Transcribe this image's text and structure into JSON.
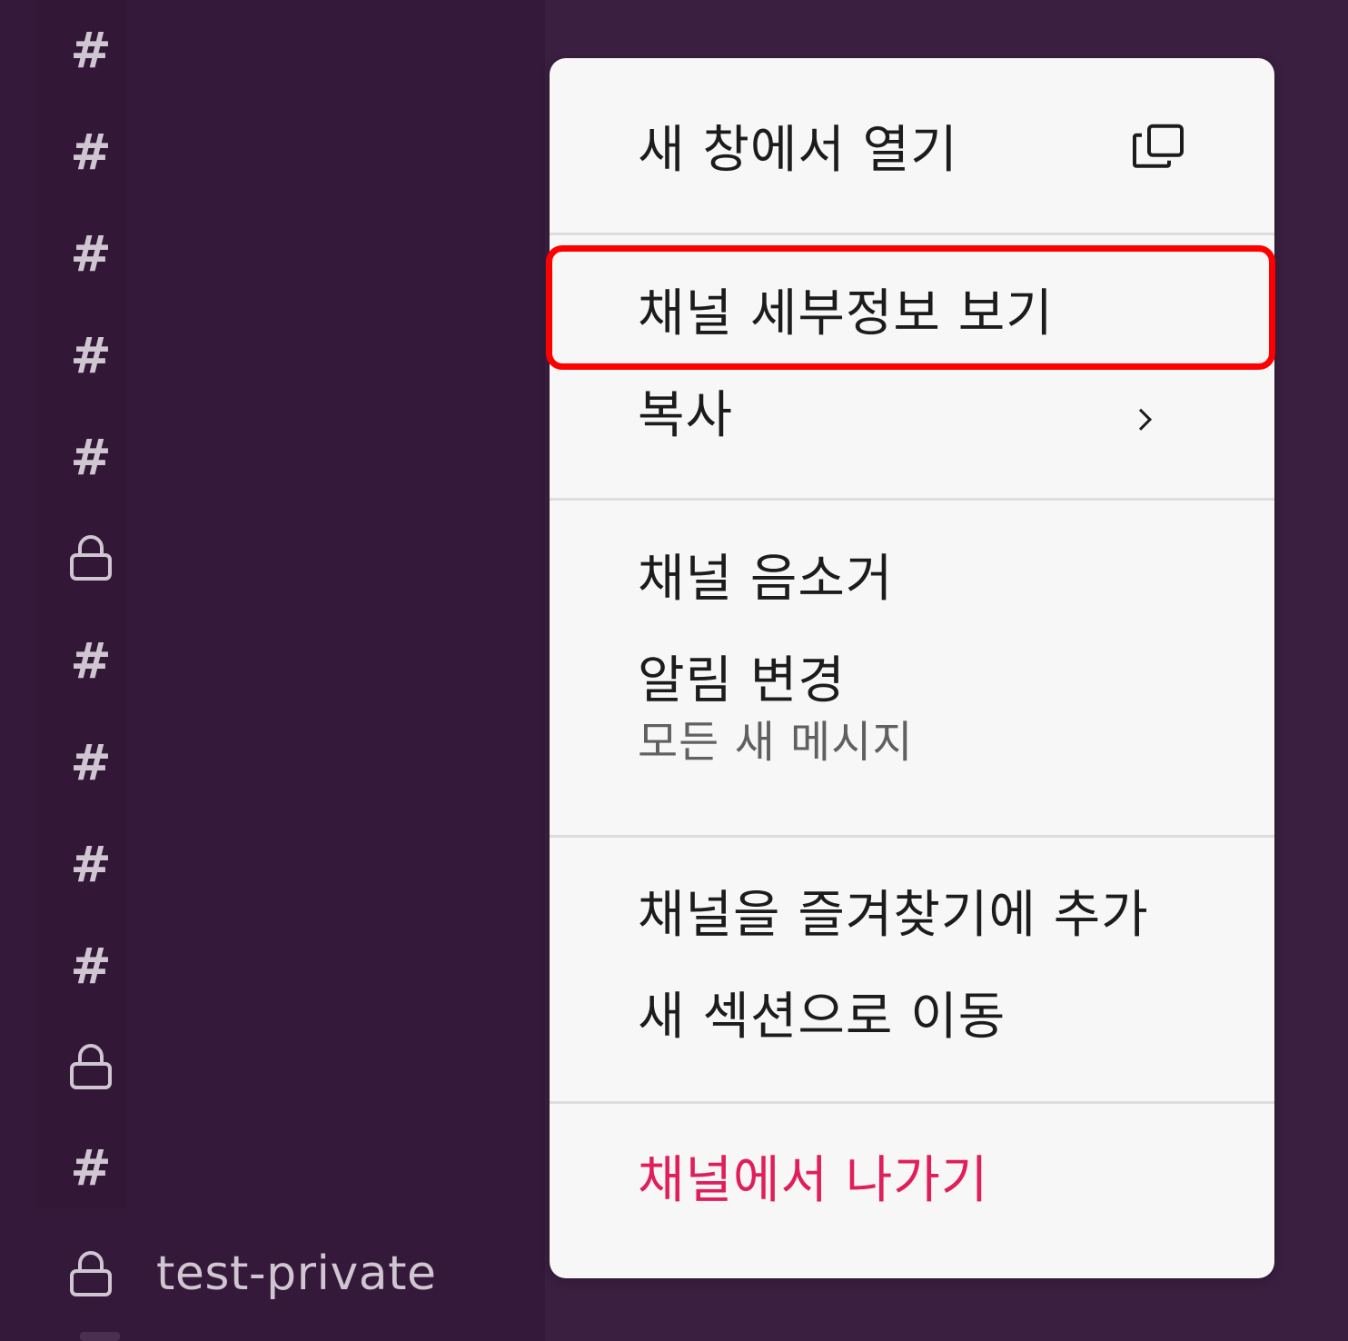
{
  "sidebar": {
    "icons": [
      "hash-icon",
      "hash-icon",
      "hash-icon",
      "hash-icon",
      "hash-icon",
      "lock-icon",
      "hash-icon",
      "hash-icon",
      "hash-icon",
      "hash-icon",
      "lock-icon",
      "hash-icon"
    ],
    "hash_glyph": "#",
    "visible_channel": {
      "icon": "lock-icon",
      "name": "test-private"
    }
  },
  "context_menu": {
    "open_in_new_window": {
      "label": "새 창에서 열기",
      "icon": "new-window-icon"
    },
    "view_channel_details": {
      "label": "채널 세부정보 보기",
      "highlighted": true
    },
    "copy": {
      "label": "복사",
      "icon": "chevron-right-icon"
    },
    "mute_channel": {
      "label": "채널 음소거"
    },
    "change_notifications": {
      "label": "알림 변경",
      "sublabel": "모든 새 메시지"
    },
    "add_to_favorites": {
      "label": "채널을 즐겨찾기에 추가"
    },
    "move_to_new_section": {
      "label": "새 섹션으로 이동"
    },
    "leave_channel": {
      "label": "채널에서 나가기"
    }
  },
  "colors": {
    "sidebar_bg": "#3a1f40",
    "menu_bg": "#f7f7f7",
    "danger_text": "#e01e5a",
    "highlight_border": "#ff0000"
  }
}
